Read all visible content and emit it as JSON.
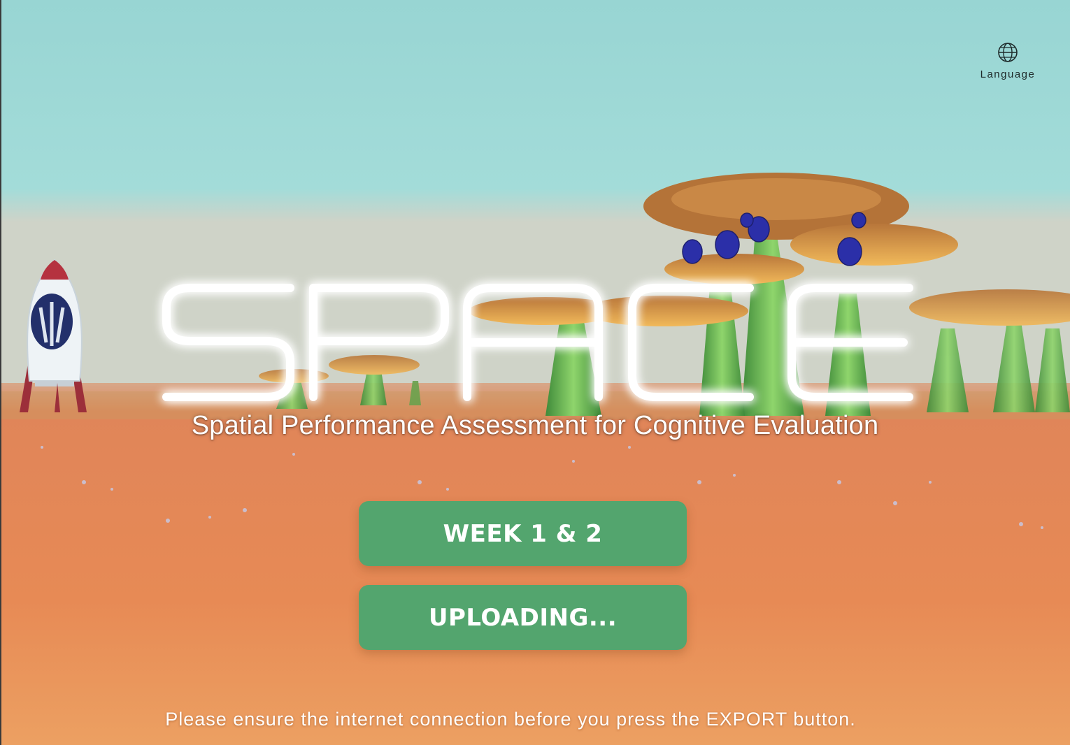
{
  "language": {
    "label": "Language",
    "icon": "globe-icon"
  },
  "title": {
    "logo_text": "SPACE",
    "subtitle": "Spatial Performance Assessment for Cognitive Evaluation"
  },
  "buttons": {
    "week": "WEEK 1 & 2",
    "upload": "UPLOADING..."
  },
  "footer": {
    "notice": "Please ensure the internet connection before you press the EXPORT button."
  },
  "colors": {
    "sky": "#9ad6d4",
    "ground": "#e68a55",
    "button": "#53a56e",
    "title_glow": "#3fb6f0"
  }
}
